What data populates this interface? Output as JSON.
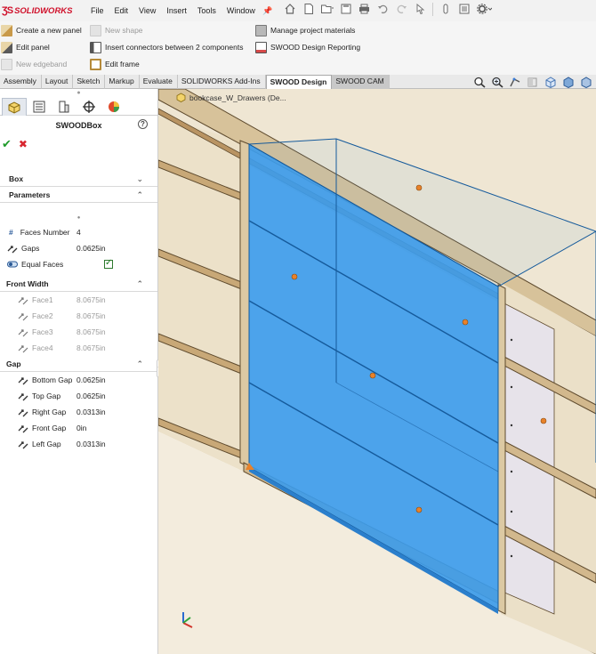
{
  "app": {
    "brand": "SOLIDWORKS",
    "menus": [
      "File",
      "Edit",
      "View",
      "Insert",
      "Tools",
      "Window"
    ]
  },
  "ribbon": {
    "create_panel": "Create a new panel",
    "new_shape": "New shape",
    "manage_materials": "Manage project materials",
    "edit_panel": "Edit panel",
    "insert_connectors": "Insert connectors between 2 components",
    "design_reporting": "SWOOD Design Reporting",
    "new_edgeband": "New edgeband",
    "edit_frame": "Edit frame"
  },
  "tabs": [
    "Assembly",
    "Layout",
    "Sketch",
    "Markup",
    "Evaluate",
    "SOLIDWORKS Add-Ins",
    "SWOOD Design",
    "SWOOD CAM"
  ],
  "active_tab": "SWOOD Design",
  "panel": {
    "title": "SWOODBox",
    "help": "?",
    "box_label": "Box",
    "parameters_label": "Parameters",
    "faces_number_label": "Faces Number",
    "faces_number_value": "4",
    "gaps_label": "Gaps",
    "gaps_value": "0.0625in",
    "equal_faces_label": "Equal Faces",
    "equal_faces_checked": true,
    "front_width_label": "Front Width",
    "faces": [
      {
        "label": "Face1",
        "value": "8.0675in"
      },
      {
        "label": "Face2",
        "value": "8.0675in"
      },
      {
        "label": "Face3",
        "value": "8.0675in"
      },
      {
        "label": "Face4",
        "value": "8.0675in"
      }
    ],
    "gap_label": "Gap",
    "gaps": [
      {
        "label": "Bottom Gap",
        "value": "0.0625in"
      },
      {
        "label": "Top Gap",
        "value": "0.0625in"
      },
      {
        "label": "Right Gap",
        "value": "0.0313in"
      },
      {
        "label": "Front Gap",
        "value": "0in"
      },
      {
        "label": "Left Gap",
        "value": "0.0313in"
      }
    ]
  },
  "viewport": {
    "document_name": "bookcase_W_Drawers (De..."
  },
  "colors": {
    "accent_blue": "#3d9be9",
    "wood": "#e9dcc4",
    "brand_red": "#d0112b"
  }
}
